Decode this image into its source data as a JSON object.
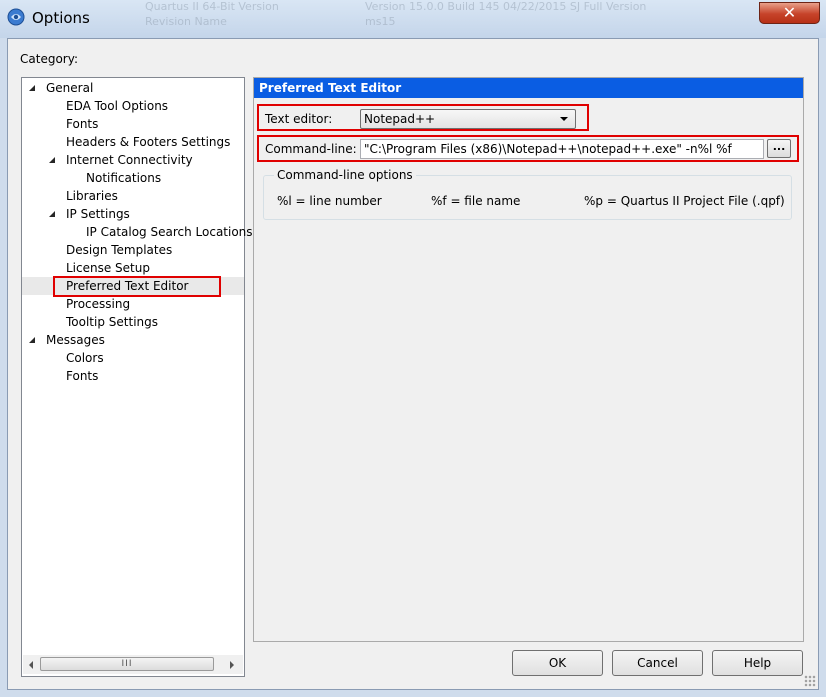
{
  "window": {
    "title": "Options",
    "close_glyph": "✕",
    "background_row1": "Quartus II 64-Bit Version",
    "background_row1_value": "Version 15.0.0 Build 145 04/22/2015 SJ Full Version",
    "background_row2": "Revision Name",
    "background_row2_value": "ms15"
  },
  "category_label": "Category:",
  "tree": [
    {
      "label": "General",
      "level": 0,
      "expanded": true
    },
    {
      "label": "EDA Tool Options",
      "level": 1
    },
    {
      "label": "Fonts",
      "level": 1
    },
    {
      "label": "Headers & Footers Settings",
      "level": 1
    },
    {
      "label": "Internet Connectivity",
      "level": 1,
      "expanded": true
    },
    {
      "label": "Notifications",
      "level": 2
    },
    {
      "label": "Libraries",
      "level": 1
    },
    {
      "label": "IP Settings",
      "level": 1,
      "expanded": true
    },
    {
      "label": "IP Catalog Search Locations",
      "level": 2
    },
    {
      "label": "Design Templates",
      "level": 1
    },
    {
      "label": "License Setup",
      "level": 1
    },
    {
      "label": "Preferred Text Editor",
      "level": 1,
      "selected": true
    },
    {
      "label": "Processing",
      "level": 1
    },
    {
      "label": "Tooltip Settings",
      "level": 1
    },
    {
      "label": "Messages",
      "level": 0,
      "expanded": true
    },
    {
      "label": "Colors",
      "level": 1
    },
    {
      "label": "Fonts",
      "level": 1
    }
  ],
  "scroll_thumb_glyph": "III",
  "panel": {
    "header": "Preferred Text Editor",
    "text_editor_label": "Text editor:",
    "text_editor_value": "Notepad++",
    "command_line_label": "Command-line:",
    "command_line_value": "\"C:\\Program Files (x86)\\Notepad++\\notepad++.exe\" -n%l %f",
    "browse_label": "...",
    "group_title": "Command-line options",
    "options": [
      "%l = line number",
      "%f = file name",
      "%p = Quartus II Project File (.qpf)"
    ]
  },
  "buttons": {
    "ok": "OK",
    "cancel": "Cancel",
    "help": "Help"
  },
  "colors": {
    "header_blue": "#0a5de3",
    "highlight_red": "#e00000"
  }
}
